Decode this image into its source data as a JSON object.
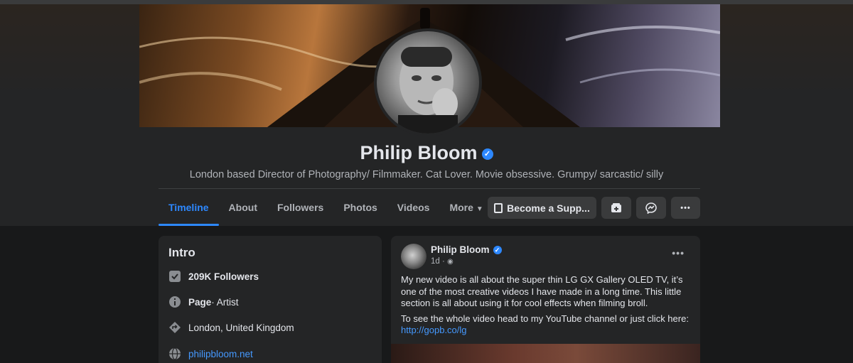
{
  "profile": {
    "name": "Philip Bloom",
    "verified_glyph": "✓",
    "bio": "London based Director of Photography/ Filmmaker. Cat Lover. Movie obsessive. Grumpy/ sarcastic/ silly"
  },
  "tabs": [
    {
      "label": "Timeline",
      "active": true
    },
    {
      "label": "About"
    },
    {
      "label": "Followers"
    },
    {
      "label": "Photos"
    },
    {
      "label": "Videos"
    },
    {
      "label": "More",
      "caret": "▼"
    }
  ],
  "actions": {
    "support_label": "Become a Supp...",
    "more_glyph": "•••"
  },
  "intro": {
    "title": "Intro",
    "followers": "209K Followers",
    "page_type_bold": "Page",
    "page_type_rest": " · Artist",
    "location": "London, United Kingdom",
    "website": "philipbloom.net"
  },
  "post": {
    "author": "Philip Bloom",
    "time": "1d · ",
    "privacy_glyph": "◉",
    "menu_glyph": "•••",
    "paragraph1": "My new video is all about the super thin LG GX Gallery OLED TV, it’s one of the most creative videos I have made in a long time. This little section is all about using it for cool effects when filming broll.",
    "paragraph2_text": "To see the whole video head to my YouTube channel or just click here: ",
    "paragraph2_link": "http://gopb.co/lg"
  },
  "icons": {
    "followers": "followers-check-icon",
    "info": "info-icon",
    "location": "location-icon",
    "website": "globe-icon"
  },
  "colors": {
    "accent": "#2d88ff",
    "link": "#4599ff",
    "background": "#18191a",
    "card": "#242526"
  }
}
